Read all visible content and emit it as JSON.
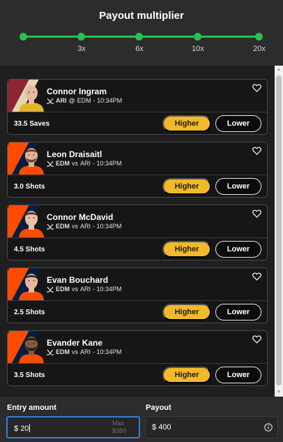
{
  "header": {
    "title": "Payout multiplier",
    "ticks": [
      "3x",
      "6x",
      "10x",
      "20x"
    ],
    "accent_color": "#27c24c"
  },
  "cards": [
    {
      "name": "Connor Ingram",
      "team": "ARI",
      "separator": "@",
      "opponent": "EDM",
      "time": "- 10:34PM",
      "stat": "33.5 Saves",
      "higher_label": "Higher",
      "lower_label": "Lower",
      "stripe_colors": [
        "#8c2633",
        "#e2d6b5"
      ],
      "jersey_color": "#e2b52c",
      "skin_color": "#e7b9a3",
      "hair_color": "#c9a07a",
      "avatar": "bald-player-avatar"
    },
    {
      "name": "Leon Draisaitl",
      "team": "EDM",
      "separator": "vs",
      "opponent": "ARI",
      "time": "- 10:34PM",
      "stat": "3.0 Shots",
      "higher_label": "Higher",
      "lower_label": "Lower",
      "stripe_colors": [
        "#ff4c00",
        "#041e42"
      ],
      "jersey_color": "#fc4c02",
      "skin_color": "#e5b197",
      "hair_color": "#6b4228",
      "avatar": "bearded-player-avatar"
    },
    {
      "name": "Connor McDavid",
      "team": "EDM",
      "separator": "vs",
      "opponent": "ARI",
      "time": "- 10:34PM",
      "stat": "4.5 Shots",
      "higher_label": "Higher",
      "lower_label": "Lower",
      "stripe_colors": [
        "#ff4c00",
        "#041e42"
      ],
      "jersey_color": "#fc4c02",
      "skin_color": "#ecbfa8",
      "hair_color": "#4a3222",
      "avatar": "player-avatar"
    },
    {
      "name": "Evan Bouchard",
      "team": "EDM",
      "separator": "vs",
      "opponent": "ARI",
      "time": "- 10:34PM",
      "stat": "2.5 Shots",
      "higher_label": "Higher",
      "lower_label": "Lower",
      "stripe_colors": [
        "#ff4c00",
        "#041e42"
      ],
      "jersey_color": "#fc4c02",
      "skin_color": "#e8b69c",
      "hair_color": "#2c2c2c",
      "avatar": "player-avatar"
    },
    {
      "name": "Evander Kane",
      "team": "EDM",
      "separator": "vs",
      "opponent": "ARI",
      "time": "- 10:34PM",
      "stat": "3.5 Shots",
      "higher_label": "Higher",
      "lower_label": "Lower",
      "stripe_colors": [
        "#ff4c00",
        "#041e42"
      ],
      "jersey_color": "#fc4c02",
      "skin_color": "#8a5a3f",
      "hair_color": "#1d1d1d",
      "avatar": "bearded-player-avatar"
    }
  ],
  "footer": {
    "entry_label": "Entry amount",
    "entry_currency": "$",
    "entry_value": "20",
    "max_label": "Max",
    "max_value": "$350",
    "payout_label": "Payout",
    "payout_currency": "$",
    "payout_value": "400",
    "entry_focus_color": "#2f7fd6"
  },
  "button_colors": {
    "higher": "#f2b92a",
    "lower_border": "#e8e8e8"
  }
}
